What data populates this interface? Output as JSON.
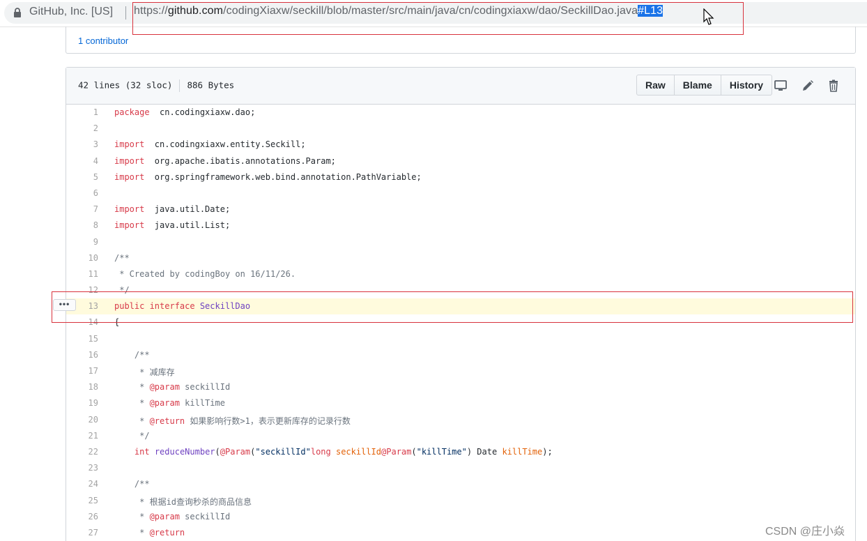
{
  "browser": {
    "site_identity": "GitHub, Inc. [US]",
    "url_scheme": "https://",
    "url_host": "github.com",
    "url_path": "/codingXiaxw/seckill/blob/master/src/main/java/cn/codingxiaxw/dao/SeckillDao.java",
    "url_fragment": "#L13",
    "icons": [
      "lock-icon",
      "cursor-icon"
    ]
  },
  "contributors": {
    "label": "1 contributor"
  },
  "file": {
    "lines_info": "42 lines (32 sloc)",
    "size_info": "886 Bytes",
    "buttons": {
      "raw": "Raw",
      "blame": "Blame",
      "history": "History"
    },
    "icons": [
      "desktop-icon",
      "pencil-icon",
      "trash-icon"
    ],
    "highlighted_line": 13,
    "line_menu_label": "•••"
  },
  "code_lines": [
    {
      "n": "1",
      "t": [
        [
          "k",
          "package"
        ],
        [
          "",
          "  cn.codingxiaxw.dao;"
        ]
      ]
    },
    {
      "n": "2",
      "t": []
    },
    {
      "n": "3",
      "t": [
        [
          "k",
          "import"
        ],
        [
          "",
          "  cn.codingxiaxw.entity.Seckill;"
        ]
      ]
    },
    {
      "n": "4",
      "t": [
        [
          "k",
          "import"
        ],
        [
          "",
          "  org.apache.ibatis.annotations.Param;"
        ]
      ]
    },
    {
      "n": "5",
      "t": [
        [
          "k",
          "import"
        ],
        [
          "",
          "  org.springframework.web.bind.annotation.PathVariable;"
        ]
      ]
    },
    {
      "n": "6",
      "t": []
    },
    {
      "n": "7",
      "t": [
        [
          "k",
          "import"
        ],
        [
          "",
          "  java.util.Date;"
        ]
      ]
    },
    {
      "n": "8",
      "t": [
        [
          "k",
          "import"
        ],
        [
          "",
          "  java.util.List;"
        ]
      ]
    },
    {
      "n": "9",
      "t": []
    },
    {
      "n": "10",
      "t": [
        [
          "c",
          "/**"
        ]
      ]
    },
    {
      "n": "11",
      "t": [
        [
          "c",
          " * Created by codingBoy on 16/11/26."
        ]
      ]
    },
    {
      "n": "12",
      "t": [
        [
          "c",
          " */"
        ]
      ]
    },
    {
      "n": "13",
      "t": [
        [
          "k",
          "public interface"
        ],
        [
          "",
          " "
        ],
        [
          "f",
          "SeckillDao"
        ]
      ]
    },
    {
      "n": "14",
      "t": [
        [
          "",
          "{"
        ]
      ]
    },
    {
      "n": "15",
      "t": []
    },
    {
      "n": "16",
      "t": [
        [
          "c",
          "    /**"
        ]
      ]
    },
    {
      "n": "17",
      "t": [
        [
          "c",
          "     * 减库存"
        ]
      ]
    },
    {
      "n": "18",
      "t": [
        [
          "c",
          "     * "
        ],
        [
          "tag",
          "@param"
        ],
        [
          "c",
          " seckillId"
        ]
      ]
    },
    {
      "n": "19",
      "t": [
        [
          "c",
          "     * "
        ],
        [
          "tag",
          "@param"
        ],
        [
          "c",
          " killTime"
        ]
      ]
    },
    {
      "n": "20",
      "t": [
        [
          "c",
          "     * "
        ],
        [
          "tag",
          "@return"
        ],
        [
          "c",
          " 如果影响行数>1，表示更新库存的记录行数"
        ]
      ]
    },
    {
      "n": "21",
      "t": [
        [
          "c",
          "     */"
        ]
      ]
    },
    {
      "n": "22",
      "t": [
        [
          "",
          "    "
        ],
        [
          "k",
          "int"
        ],
        [
          "",
          " "
        ],
        [
          "f",
          "reduceNumber"
        ],
        [
          "",
          "("
        ],
        [
          "k",
          "@Param"
        ],
        [
          "",
          "("
        ],
        [
          "s",
          "\"seckillId\""
        ],
        [
          ") "
        ],
        [
          "k",
          "long"
        ],
        [
          "",
          " "
        ],
        [
          "v",
          "seckillId"
        ],
        [
          ", "
        ],
        [
          "k",
          "@Param"
        ],
        [
          "",
          "("
        ],
        [
          "s",
          "\"killTime\""
        ],
        [
          "",
          ") Date "
        ],
        [
          "v",
          "killTime"
        ],
        [
          "",
          ");"
        ]
      ]
    },
    {
      "n": "23",
      "t": []
    },
    {
      "n": "24",
      "t": [
        [
          "c",
          "    /**"
        ]
      ]
    },
    {
      "n": "25",
      "t": [
        [
          "c",
          "     * 根据id查询秒杀的商品信息"
        ]
      ]
    },
    {
      "n": "26",
      "t": [
        [
          "c",
          "     * "
        ],
        [
          "tag",
          "@param"
        ],
        [
          "c",
          " seckillId"
        ]
      ]
    },
    {
      "n": "27",
      "t": [
        [
          "c",
          "     * "
        ],
        [
          "tag",
          "@return"
        ]
      ]
    }
  ],
  "watermark": "CSDN @庄小焱"
}
